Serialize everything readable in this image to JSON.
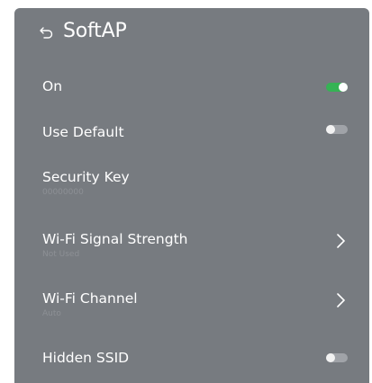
{
  "header": {
    "title": "SoftAP",
    "back_icon": "back-arrow-icon"
  },
  "colors": {
    "panel_bg": "#777b80",
    "toggle_on": "#35b354",
    "toggle_off": "#a0a3a8",
    "text": "#ffffff",
    "subtext": "#8d9095"
  },
  "items": [
    {
      "label": "On",
      "control": "toggle",
      "state": "on"
    },
    {
      "label": "Use Default",
      "control": "toggle",
      "state": "off"
    },
    {
      "label": "Security Key",
      "value": "00000000"
    },
    {
      "label": "Wi-Fi Signal Strength",
      "value": "Not Used",
      "control": "chevron-right-icon"
    },
    {
      "label": "Wi-Fi Channel",
      "value": "Auto",
      "control": "chevron-right-icon"
    },
    {
      "label": "Hidden SSID",
      "control": "toggle",
      "state": "off"
    }
  ]
}
